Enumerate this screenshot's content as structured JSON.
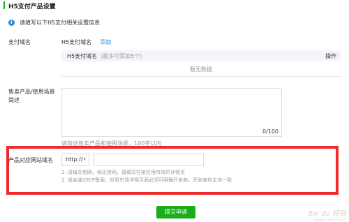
{
  "section": {
    "title": "H5支付产品设置"
  },
  "notice": {
    "text": "请填写以下H5支付相关设置信息"
  },
  "domain": {
    "label": "支付域名",
    "name": "H5支付域名",
    "add": "添加",
    "table": {
      "col_name": "H5支付域名",
      "col_hint": "（最多可添加5个）",
      "col_op": "操作",
      "empty": "暂无数据"
    }
  },
  "description": {
    "label_line1": "售卖产品/使用场景",
    "label_line2": "简述",
    "value": "",
    "counter": "0/100",
    "hint": "请简述售卖产品和使用场景，100字以内"
  },
  "site": {
    "label": "产品对应网站域名",
    "protocol": "http://",
    "url_value": "",
    "rules": [
      "1. 请填写官网，如无官网，请填写在某应用市场的详情页",
      "2. 域名通过ICP备案，应用市场详情页面必须可明确开发商，开发商和主体一致"
    ]
  },
  "submit": {
    "label": "提交申请"
  },
  "watermark": {
    "text": "Bai du 经验",
    "sub": "jingyan.baidu.com"
  },
  "colors": {
    "accent": "#1aad19",
    "link": "#2a8bd8",
    "highlight": "#ee2b2b"
  }
}
